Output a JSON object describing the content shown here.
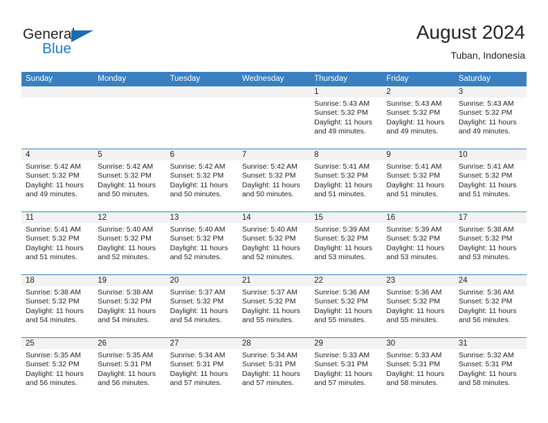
{
  "logo": {
    "text_top": "General",
    "text_bottom": "Blue",
    "triangle_color": "#1a6cb5",
    "blue_color": "#1a7ac4"
  },
  "header": {
    "title": "August 2024",
    "subtitle": "Tuban, Indonesia"
  },
  "colors": {
    "header_blue": "#3a7fc0",
    "day_head_gray": "#f2f2f2",
    "text": "#222222"
  },
  "weekdays": [
    "Sunday",
    "Monday",
    "Tuesday",
    "Wednesday",
    "Thursday",
    "Friday",
    "Saturday"
  ],
  "weeks": [
    [
      {
        "day": "",
        "sunrise": "",
        "sunset": "",
        "daylight": "",
        "empty": true
      },
      {
        "day": "",
        "sunrise": "",
        "sunset": "",
        "daylight": "",
        "empty": true
      },
      {
        "day": "",
        "sunrise": "",
        "sunset": "",
        "daylight": "",
        "empty": true
      },
      {
        "day": "",
        "sunrise": "",
        "sunset": "",
        "daylight": "",
        "empty": true
      },
      {
        "day": "1",
        "sunrise": "Sunrise: 5:43 AM",
        "sunset": "Sunset: 5:32 PM",
        "daylight": "Daylight: 11 hours and 49 minutes."
      },
      {
        "day": "2",
        "sunrise": "Sunrise: 5:43 AM",
        "sunset": "Sunset: 5:32 PM",
        "daylight": "Daylight: 11 hours and 49 minutes."
      },
      {
        "day": "3",
        "sunrise": "Sunrise: 5:43 AM",
        "sunset": "Sunset: 5:32 PM",
        "daylight": "Daylight: 11 hours and 49 minutes."
      }
    ],
    [
      {
        "day": "4",
        "sunrise": "Sunrise: 5:42 AM",
        "sunset": "Sunset: 5:32 PM",
        "daylight": "Daylight: 11 hours and 49 minutes."
      },
      {
        "day": "5",
        "sunrise": "Sunrise: 5:42 AM",
        "sunset": "Sunset: 5:32 PM",
        "daylight": "Daylight: 11 hours and 50 minutes."
      },
      {
        "day": "6",
        "sunrise": "Sunrise: 5:42 AM",
        "sunset": "Sunset: 5:32 PM",
        "daylight": "Daylight: 11 hours and 50 minutes."
      },
      {
        "day": "7",
        "sunrise": "Sunrise: 5:42 AM",
        "sunset": "Sunset: 5:32 PM",
        "daylight": "Daylight: 11 hours and 50 minutes."
      },
      {
        "day": "8",
        "sunrise": "Sunrise: 5:41 AM",
        "sunset": "Sunset: 5:32 PM",
        "daylight": "Daylight: 11 hours and 51 minutes."
      },
      {
        "day": "9",
        "sunrise": "Sunrise: 5:41 AM",
        "sunset": "Sunset: 5:32 PM",
        "daylight": "Daylight: 11 hours and 51 minutes."
      },
      {
        "day": "10",
        "sunrise": "Sunrise: 5:41 AM",
        "sunset": "Sunset: 5:32 PM",
        "daylight": "Daylight: 11 hours and 51 minutes."
      }
    ],
    [
      {
        "day": "11",
        "sunrise": "Sunrise: 5:41 AM",
        "sunset": "Sunset: 5:32 PM",
        "daylight": "Daylight: 11 hours and 51 minutes."
      },
      {
        "day": "12",
        "sunrise": "Sunrise: 5:40 AM",
        "sunset": "Sunset: 5:32 PM",
        "daylight": "Daylight: 11 hours and 52 minutes."
      },
      {
        "day": "13",
        "sunrise": "Sunrise: 5:40 AM",
        "sunset": "Sunset: 5:32 PM",
        "daylight": "Daylight: 11 hours and 52 minutes."
      },
      {
        "day": "14",
        "sunrise": "Sunrise: 5:40 AM",
        "sunset": "Sunset: 5:32 PM",
        "daylight": "Daylight: 11 hours and 52 minutes."
      },
      {
        "day": "15",
        "sunrise": "Sunrise: 5:39 AM",
        "sunset": "Sunset: 5:32 PM",
        "daylight": "Daylight: 11 hours and 53 minutes."
      },
      {
        "day": "16",
        "sunrise": "Sunrise: 5:39 AM",
        "sunset": "Sunset: 5:32 PM",
        "daylight": "Daylight: 11 hours and 53 minutes."
      },
      {
        "day": "17",
        "sunrise": "Sunrise: 5:38 AM",
        "sunset": "Sunset: 5:32 PM",
        "daylight": "Daylight: 11 hours and 53 minutes."
      }
    ],
    [
      {
        "day": "18",
        "sunrise": "Sunrise: 5:38 AM",
        "sunset": "Sunset: 5:32 PM",
        "daylight": "Daylight: 11 hours and 54 minutes."
      },
      {
        "day": "19",
        "sunrise": "Sunrise: 5:38 AM",
        "sunset": "Sunset: 5:32 PM",
        "daylight": "Daylight: 11 hours and 54 minutes."
      },
      {
        "day": "20",
        "sunrise": "Sunrise: 5:37 AM",
        "sunset": "Sunset: 5:32 PM",
        "daylight": "Daylight: 11 hours and 54 minutes."
      },
      {
        "day": "21",
        "sunrise": "Sunrise: 5:37 AM",
        "sunset": "Sunset: 5:32 PM",
        "daylight": "Daylight: 11 hours and 55 minutes."
      },
      {
        "day": "22",
        "sunrise": "Sunrise: 5:36 AM",
        "sunset": "Sunset: 5:32 PM",
        "daylight": "Daylight: 11 hours and 55 minutes."
      },
      {
        "day": "23",
        "sunrise": "Sunrise: 5:36 AM",
        "sunset": "Sunset: 5:32 PM",
        "daylight": "Daylight: 11 hours and 55 minutes."
      },
      {
        "day": "24",
        "sunrise": "Sunrise: 5:36 AM",
        "sunset": "Sunset: 5:32 PM",
        "daylight": "Daylight: 11 hours and 56 minutes."
      }
    ],
    [
      {
        "day": "25",
        "sunrise": "Sunrise: 5:35 AM",
        "sunset": "Sunset: 5:32 PM",
        "daylight": "Daylight: 11 hours and 56 minutes."
      },
      {
        "day": "26",
        "sunrise": "Sunrise: 5:35 AM",
        "sunset": "Sunset: 5:31 PM",
        "daylight": "Daylight: 11 hours and 56 minutes."
      },
      {
        "day": "27",
        "sunrise": "Sunrise: 5:34 AM",
        "sunset": "Sunset: 5:31 PM",
        "daylight": "Daylight: 11 hours and 57 minutes."
      },
      {
        "day": "28",
        "sunrise": "Sunrise: 5:34 AM",
        "sunset": "Sunset: 5:31 PM",
        "daylight": "Daylight: 11 hours and 57 minutes."
      },
      {
        "day": "29",
        "sunrise": "Sunrise: 5:33 AM",
        "sunset": "Sunset: 5:31 PM",
        "daylight": "Daylight: 11 hours and 57 minutes."
      },
      {
        "day": "30",
        "sunrise": "Sunrise: 5:33 AM",
        "sunset": "Sunset: 5:31 PM",
        "daylight": "Daylight: 11 hours and 58 minutes."
      },
      {
        "day": "31",
        "sunrise": "Sunrise: 5:32 AM",
        "sunset": "Sunset: 5:31 PM",
        "daylight": "Daylight: 11 hours and 58 minutes."
      }
    ]
  ]
}
